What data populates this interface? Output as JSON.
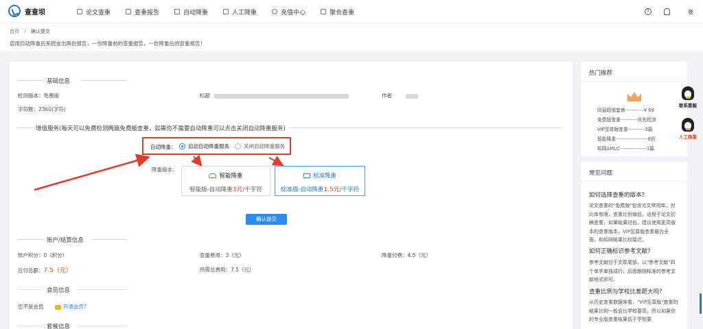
{
  "app": {
    "logo_text": "查查坝"
  },
  "nav": {
    "items": [
      {
        "label": "论文查重"
      },
      {
        "label": "查重报告"
      },
      {
        "label": "自动降重"
      },
      {
        "label": "人工降重"
      },
      {
        "label": "充值中心"
      },
      {
        "label": "聚合查重"
      }
    ],
    "help_glyph": "?",
    "user_name": "张"
  },
  "breadcrumb": {
    "home": "首页",
    "sep": "/",
    "current": "确认提交"
  },
  "notice": "启用自动降重后系统会出两份报告，一份降重前的查重报告，一份降重后的查重报告！",
  "basic": {
    "title": "基础信息",
    "version_label": "检测版本：",
    "version_value": "免费版",
    "title_label": "标题",
    "author_label": "作者",
    "word_count_label": "字符数：",
    "word_count_value": "2360(字符)"
  },
  "value_service": {
    "title": "增值服务(每天可以免费检测两篇免费版查重，如果你不需要自动降重可以点击关闭自动降重服务)",
    "auto_label": "自动降重：",
    "option_on": "启动自动降重服务",
    "option_off": "关闭自动降重服务",
    "version_label": "降重版本：",
    "cards": [
      {
        "title": "智能降重",
        "desc_prefix": "智能版-自动降重",
        "price": "3元",
        "desc_suffix": "/千字符"
      },
      {
        "title": "标准降重",
        "desc_prefix": "标准版-自动降重",
        "price": "1.5元",
        "desc_suffix": "/千字符"
      }
    ],
    "submit_label": "确认提交"
  },
  "account": {
    "title": "账户/结算信息",
    "points_label": "账户积分：",
    "points_value": "0（积分）",
    "check_fee_label": "查重费用：",
    "check_fee_value": "3（元）",
    "reduce_fee_label": "降重付费：",
    "reduce_fee_value": "4.5（元）",
    "total_label": "应付总额：",
    "total_value": "7.5（元）",
    "need_label": "所需总费用：",
    "need_value": "7.5（元）"
  },
  "member": {
    "title": "会员信息",
    "status": "您不是会员",
    "link": "开通会员?"
  },
  "package": {
    "title": "套餐信息"
  },
  "sidebar": {
    "hot_title": "热门推荐",
    "recommend": [
      "同窗超值套餐-----------¥ 69",
      "免费版查重----------优先检测",
      "VIP至尊版查重----------3篇",
      "智能降重-------------------8折",
      "知网AMLC----------------1篇"
    ],
    "faq_title": "常见问题",
    "faqs": [
      {
        "q": "如何选择查重的版本?",
        "a": "论文查重的\"免费版\"包含论文常用库，对比库有限，查重比例偏低，适用于论文初稿查重，如果结果过低，建议使用更高版本的查重版本，VIP至尊版查重最为全面，和知网结果比较接近。"
      },
      {
        "q": "如何正确标识参考文献?",
        "a": "参考文献位于文章尾部，以\"参考文献\"四个单字单独成行，后面跟随标准的参考文献格式即可。"
      },
      {
        "q": "查重比例与学校比差距大吗?",
        "a": "从历史查重数据来看，\"VIP至尊版\"查重的结果比例一般会比学校要高，所以如果你的专业版查重结果低于学校要"
      }
    ]
  },
  "float_service": {
    "contact": "联系客服",
    "manual": "人工降重"
  },
  "colors": {
    "accent": "#2b8cf0",
    "red": "#e64a19",
    "highlight_border": "#e03c2c"
  }
}
